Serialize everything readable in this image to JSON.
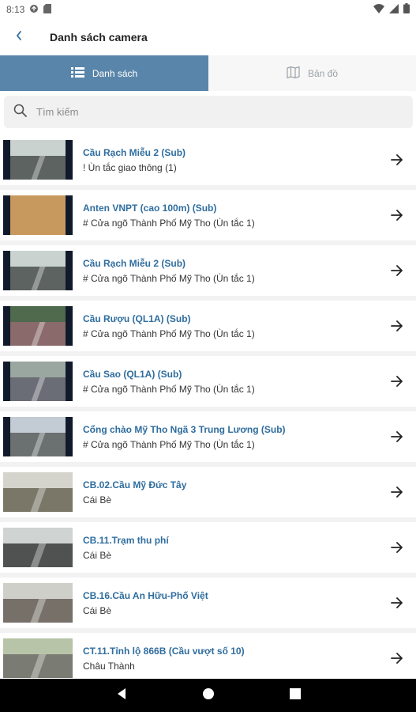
{
  "status_bar": {
    "time": "8:13"
  },
  "header": {
    "title": "Danh sách camera"
  },
  "tabs": [
    {
      "label": "Danh sách",
      "icon": "list-icon",
      "active": true
    },
    {
      "label": "Bản đồ",
      "icon": "map-icon",
      "active": false
    }
  ],
  "search": {
    "placeholder": "Tìm kiếm",
    "value": ""
  },
  "cameras": [
    {
      "title": "Cầu Rạch Miễu 2 (Sub)",
      "subtitle": "! Ùn tắc giao thông (1)"
    },
    {
      "title": "Anten VNPT (cao 100m) (Sub)",
      "subtitle": "# Cửa ngõ Thành Phố Mỹ Tho (Ùn tắc 1)"
    },
    {
      "title": "Cầu Rạch Miễu 2 (Sub)",
      "subtitle": "# Cửa ngõ Thành Phố Mỹ Tho (Ùn tắc 1)"
    },
    {
      "title": "Cầu Rượu (QL1A) (Sub)",
      "subtitle": "# Cửa ngõ Thành Phố Mỹ Tho (Ùn tắc 1)"
    },
    {
      "title": "Cầu Sao (QL1A) (Sub)",
      "subtitle": "# Cửa ngõ Thành Phố Mỹ Tho (Ùn tắc 1)"
    },
    {
      "title": "Cổng chào Mỹ Tho Ngã 3 Trung Lương (Sub)",
      "subtitle": "# Cửa ngõ Thành Phố Mỹ Tho (Ùn tắc 1)"
    },
    {
      "title": "CB.02.Cầu Mỹ Đức Tây",
      "subtitle": "Cái Bè"
    },
    {
      "title": "CB.11.Trạm thu phí",
      "subtitle": "Cái Bè"
    },
    {
      "title": "CB.16.Cầu An Hữu-Phố Việt",
      "subtitle": "Cái Bè"
    },
    {
      "title": "CT.11.Tỉnh lộ 866B (Cầu vượt số 10)",
      "subtitle": "Châu Thành"
    }
  ],
  "colors": {
    "accent": "#5a85aa",
    "title_blue": "#2f6d9e"
  }
}
